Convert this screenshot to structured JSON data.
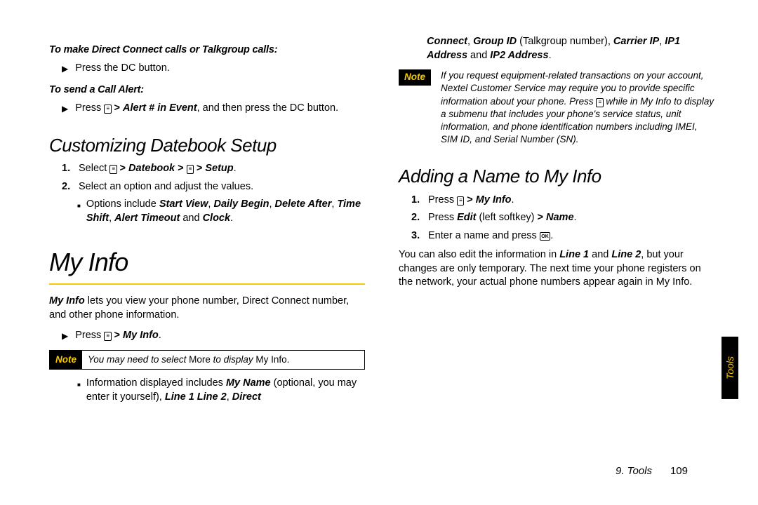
{
  "left": {
    "sub1": "To make Direct Connect calls or Talkgroup calls:",
    "b1": "Press the DC button.",
    "sub2": "To send a Call Alert:",
    "b2_pre": "Press ",
    "b2_icon": "≡",
    "b2_mid": " > ",
    "b2_em": "Alert # in Event",
    "b2_post": ", and then press the DC button.",
    "h2a": "Customizing Datebook Setup",
    "ol1_pre": "Select ",
    "ol1_icon": "≡",
    "ol1_a": " > ",
    "ol1_b": "Datebook",
    "ol1_c": " > ",
    "ol1_icon2": "≡",
    "ol1_d": " > ",
    "ol1_e": "Setup",
    "ol1_dot": ".",
    "ol2": "Select an option and adjust the values.",
    "sq_pre": "Options include ",
    "sq_a": "Start View",
    "sq_b": "Daily Begin",
    "sq_c": "Delete After",
    "sq_d": "Time Shift",
    "sq_e": "Alert Timeout",
    "sq_and": " and ",
    "sq_f": "Clock",
    "sq_dot": ".",
    "h1": "My Info",
    "p1_a": "My Info",
    "p1_b": " lets you view your phone number, Direct Connect number, and other phone information.",
    "b3_pre": "Press ",
    "b3_icon": "≡",
    "b3_a": " > ",
    "b3_b": "My Info",
    "b3_dot": ".",
    "note1_label": "Note",
    "note1_a": "You may need to select ",
    "note1_b": "More",
    "note1_c": " to display ",
    "note1_d": "My Info",
    "note1_e": ".",
    "sq2_pre": "Information displayed includes ",
    "sq2_a": "My Name",
    "sq2_b": " (optional, you may enter it yourself), ",
    "sq2_c": "Line 1",
    "sq2_sp": " ",
    "sq2_d": "Line 2",
    "sq2_e": ", ",
    "sq2_f": "Direct"
  },
  "right": {
    "cont_a": "Connect",
    "cont_b": ", ",
    "cont_c": "Group ID",
    "cont_d": " (Talkgroup number), ",
    "cont_e": "Carrier IP",
    "cont_f": ", ",
    "cont_g": "IP1 Address",
    "cont_h": " and ",
    "cont_i": "IP2 Address",
    "cont_j": ".",
    "note2_label": "Note",
    "note2_a": "If you request equipment-related transactions on your account, Nextel Customer Service may require you to provide specific information about your phone. Press ",
    "note2_icon": "≡",
    "note2_b": " while in My Info to display a submenu that includes your phone's service status, unit information, and phone identification numbers including IMEI, SIM ID, and Serial Number (SN).",
    "h2b": "Adding a Name to My Info",
    "r1_pre": "Press ",
    "r1_icon": "≡",
    "r1_a": " > ",
    "r1_b": "My Info",
    "r1_dot": ".",
    "r2_pre": "Press ",
    "r2_a": "Edit",
    "r2_b": " (left softkey) ",
    "r2_gt": "> ",
    "r2_c": "Name",
    "r2_dot": ".",
    "r3_a": "Enter a name and press ",
    "r3_ok": "OK",
    "r3_dot": ".",
    "p2_a": "You can also edit the information in ",
    "p2_b": "Line 1",
    "p2_c": " and ",
    "p2_d": "Line 2",
    "p2_e": ", but your changes are only temporary. The next time your phone registers on the network, your actual phone numbers appear again in My Info."
  },
  "footer": {
    "chapter": "9. Tools",
    "page": "109"
  },
  "sidetab": "Tools"
}
